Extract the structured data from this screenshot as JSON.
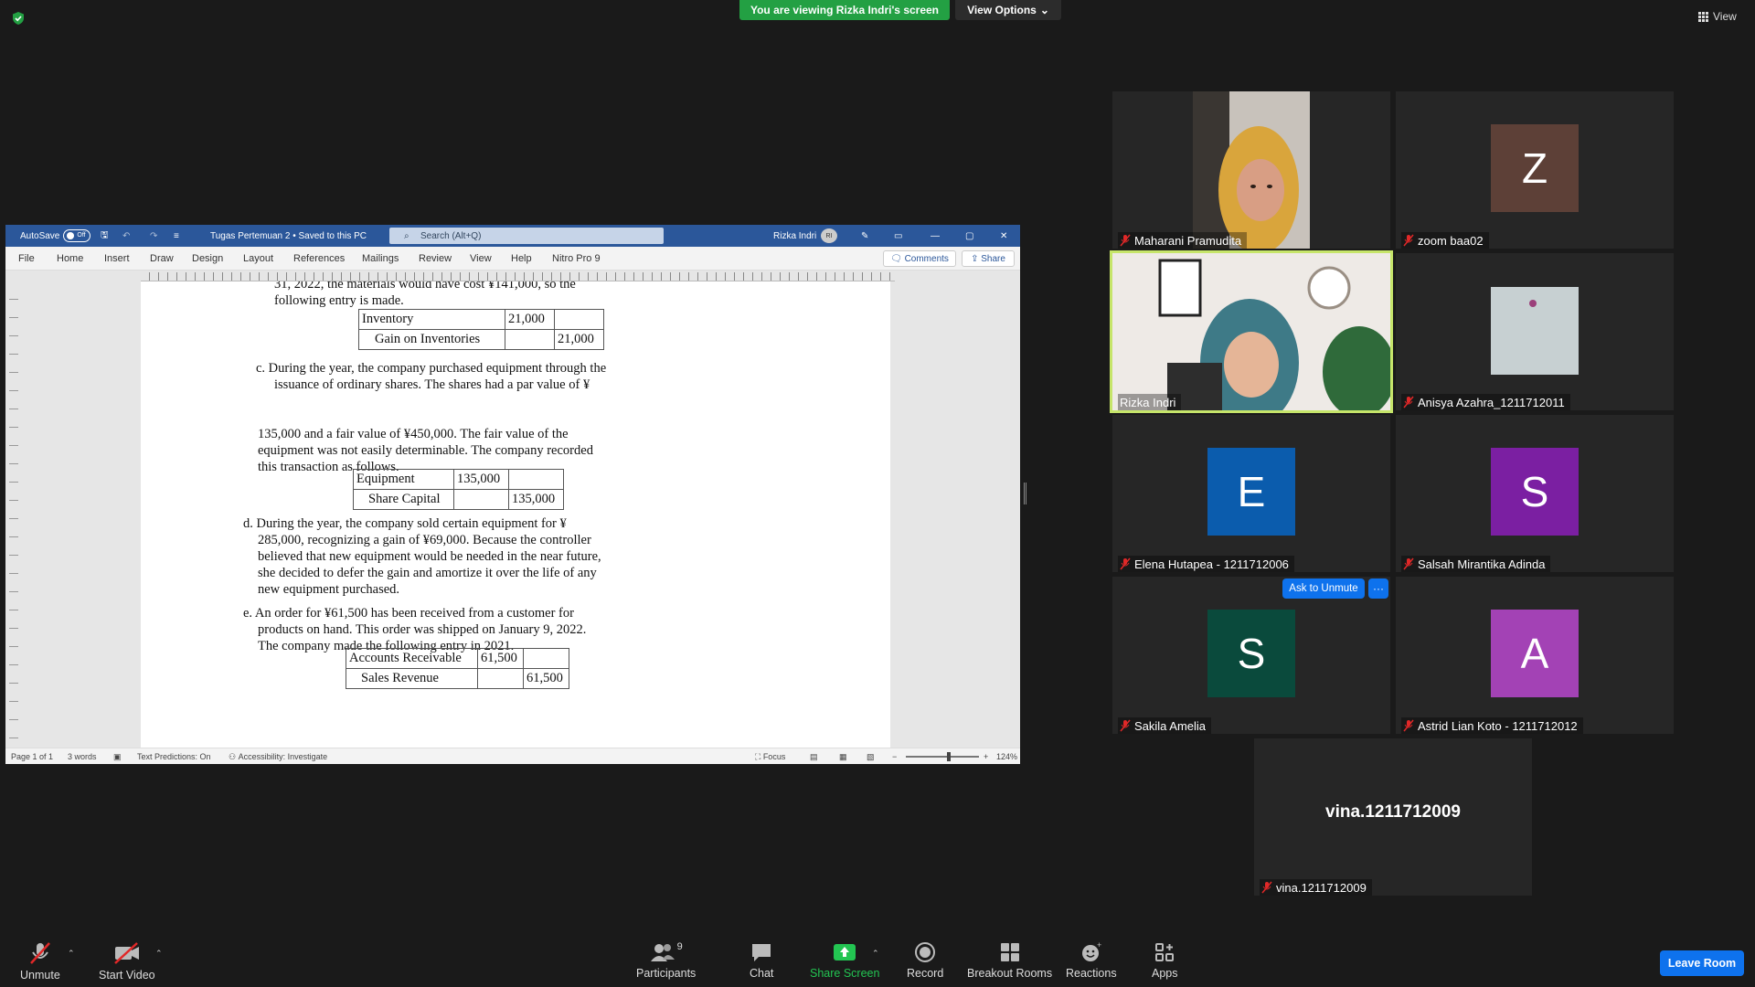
{
  "banner": {
    "viewing": "You are viewing Rizka Indri's screen",
    "view_options": "View Options",
    "view": "View"
  },
  "word": {
    "autosave": "AutoSave",
    "autosave_state": "Off",
    "doc_title": "Tugas Pertemuan 2 • Saved to this PC",
    "search_placeholder": "Search (Alt+Q)",
    "user": "Rizka Indri",
    "user_initials": "RI",
    "tabs": [
      "File",
      "Home",
      "Insert",
      "Draw",
      "Design",
      "Layout",
      "References",
      "Mailings",
      "Review",
      "View",
      "Help",
      "Nitro Pro 9"
    ],
    "comments": "Comments",
    "share": "Share",
    "status": {
      "page": "Page 1 of 1",
      "words": "3 words",
      "text_predictions": "Text Predictions: On",
      "accessibility": "Accessibility: Investigate",
      "focus": "Focus",
      "zoom": "124%"
    },
    "doc": {
      "lines_top": [
        "31, 2022, the materials would have cost ¥141,000, so the",
        "following entry is made."
      ],
      "table1": [
        [
          "Inventory",
          "21,000",
          ""
        ],
        [
          "Gain on Inventories",
          "",
          "21,000"
        ]
      ],
      "c_lines": [
        "c. During the year, the company purchased equipment through the",
        "issuance of ordinary shares. The shares had a par value of ¥"
      ],
      "c2_lines": [
        "135,000 and a fair value of ¥450,000. The fair value of the",
        "equipment was not easily determinable. The company recorded",
        "this transaction as follows."
      ],
      "table2": [
        [
          "Equipment",
          "135,000",
          ""
        ],
        [
          "Share Capital",
          "",
          "135,000"
        ]
      ],
      "d_lines": [
        "d. During the year, the company sold certain equipment for ¥",
        "285,000, recognizing a gain of ¥69,000. Because the controller",
        "believed that new equipment would be needed in the near future,",
        "she decided to defer the gain and amortize it over the life of any",
        "new equipment purchased."
      ],
      "e_lines": [
        "e. An order for ¥61,500 has been received from a customer for",
        "products on hand. This order was shipped on January 9, 2022.",
        "The company made the following entry in 2021."
      ],
      "table3": [
        [
          "Accounts Receivable",
          "61,500",
          ""
        ],
        [
          "Sales Revenue",
          "",
          "61,500"
        ]
      ]
    }
  },
  "participants": [
    {
      "name": "Maharani Pramudita",
      "type": "video"
    },
    {
      "name": "zoom baa02",
      "initial": "Z",
      "color": "#5d4037"
    },
    {
      "name": "Rizka Indri",
      "type": "video",
      "active": true
    },
    {
      "name": "Anisya Azahra_1211712011",
      "type": "image"
    },
    {
      "name": "Elena Hutapea - 1211712006",
      "initial": "E",
      "color": "#0b5cad"
    },
    {
      "name": "Salsah Mirantika Adinda",
      "initial": "S",
      "color": "#7b1fa2"
    },
    {
      "name": "Sakila Amelia",
      "initial": "S",
      "color": "#0a4a3c"
    },
    {
      "name": "Astrid Lian Koto - 1211712012",
      "initial": "A",
      "color": "#a342b5"
    },
    {
      "name": "vina.1211712009",
      "big": "vina.1211712009"
    }
  ],
  "ask_unmute": "Ask to Unmute",
  "ask_more": "···",
  "toolbar": {
    "unmute": "Unmute",
    "start_video": "Start Video",
    "participants": "Participants",
    "participants_count": "9",
    "chat": "Chat",
    "share_screen": "Share Screen",
    "record": "Record",
    "breakout": "Breakout Rooms",
    "reactions": "Reactions",
    "apps": "Apps",
    "leave": "Leave Room"
  },
  "colors": {
    "accent": "#0e72ed",
    "share_green": "#23a043",
    "word_blue": "#2b579a",
    "active_speaker": "#c6e56a"
  }
}
